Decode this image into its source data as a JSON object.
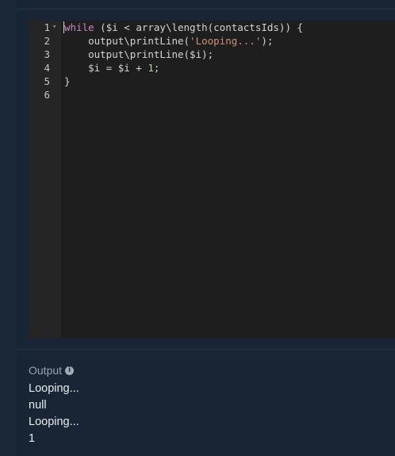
{
  "editor": {
    "line_numbers": [
      "1",
      "2",
      "3",
      "4",
      "5",
      "6"
    ],
    "fold_marker": "▾",
    "lines": [
      [
        {
          "t": "while",
          "k": "keyword"
        },
        {
          "t": " ($i < array\\length(contactsIds)) {",
          "k": "plain"
        }
      ],
      [
        {
          "t": "    output\\printLine(",
          "k": "plain"
        },
        {
          "t": "'Looping...'",
          "k": "string"
        },
        {
          "t": ");",
          "k": "plain"
        }
      ],
      [
        {
          "t": "    output\\printLine($i);",
          "k": "plain"
        }
      ],
      [
        {
          "t": "    $i = $i + ",
          "k": "plain"
        },
        {
          "t": "1",
          "k": "number"
        },
        {
          "t": ";",
          "k": "plain"
        }
      ],
      [
        {
          "t": "}",
          "k": "plain"
        }
      ],
      []
    ]
  },
  "output": {
    "title": "Output",
    "info_icon": "info-icon",
    "lines": [
      "Looping...",
      "null",
      "Looping...",
      "1"
    ]
  },
  "colors": {
    "background": "#192534",
    "editor_background": "#1e1e1e",
    "gutter_background": "#252526",
    "keyword": "#c586c0",
    "string": "#ce9178",
    "number": "#b5cea8",
    "text": "#d4d4d4"
  }
}
